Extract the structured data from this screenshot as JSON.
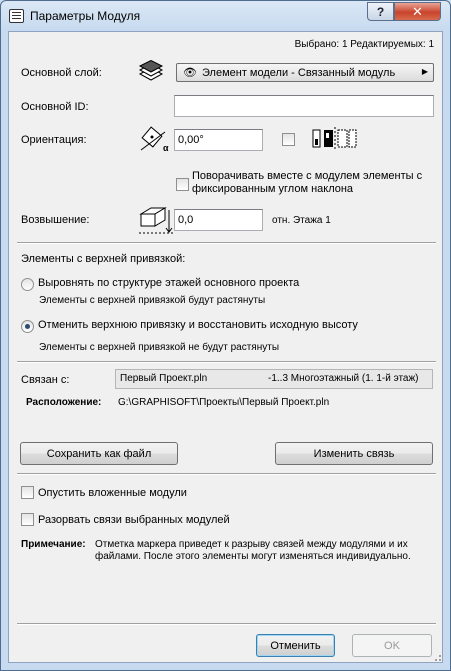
{
  "window": {
    "title": "Параметры Модуля",
    "help_glyph": "?",
    "close_glyph": "✕"
  },
  "header": {
    "selection_info": "Выбрано: 1 Редактируемых: 1"
  },
  "layer": {
    "label": "Основной слой:",
    "value": "Элемент модели - Связанный модуль",
    "eye_glyph": "👁",
    "arrow_glyph": "▶"
  },
  "main_id": {
    "label": "Основной ID:",
    "value": ""
  },
  "orientation": {
    "label": "Ориентация:",
    "value": "0,00°",
    "rotate_label": "Поворачивать вместе с модулем элементы с фиксированным углом наклона"
  },
  "elevation": {
    "label": "Возвышение:",
    "value": "0,0",
    "reference": "отн. Этажа 1"
  },
  "top_linked": {
    "heading": "Элементы с верхней привязкой:",
    "option1": "Выровнять по структуре этажей основного проекта",
    "option1_note": "Элементы с верхней привязкой будут растянуты",
    "option2": "Отменить верхнюю привязку и восстановить исходную высоту",
    "option2_note": "Элементы с верхней привязкой не будут растянуты",
    "selected": 2
  },
  "link": {
    "label": "Связан с:",
    "project": "Первый Проект.pln",
    "stories": "-1..3 Многоэтажный (1. 1-й этаж)",
    "location_label": "Расположение:",
    "location_value": "G:\\GRAPHISOFT\\Проекты\\Первый Проект.pln"
  },
  "buttons": {
    "save_as_file": "Сохранить как файл",
    "change_link": "Изменить связь",
    "cancel": "Отменить",
    "ok": "OK"
  },
  "options": {
    "skip_nested": "Опустить вложенные модули",
    "break_links": "Разорвать связи выбранных модулей"
  },
  "note": {
    "label": "Примечание:",
    "text": "Отметка маркера приведет к разрыву связей между модулями и их файлами. После этого элементы могут изменяться индивидуально."
  }
}
